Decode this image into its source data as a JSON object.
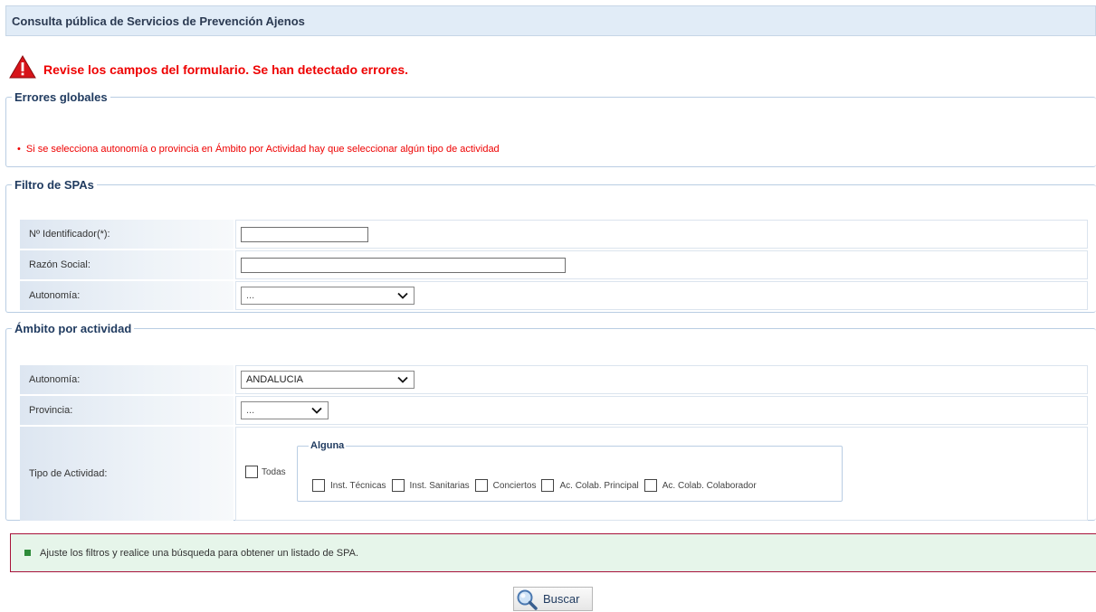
{
  "page": {
    "title": "Consulta pública de Servicios de Prevención Ajenos"
  },
  "errors": {
    "header": "Revise los campos del formulario. Se han detectado errores.",
    "icon": "warning-icon",
    "global_legend": "Errores globales",
    "items": [
      "Si se selecciona autonomía o provincia en Ámbito por Actividad hay que seleccionar algún tipo de actividad"
    ]
  },
  "filtro": {
    "legend": "Filtro de SPAs",
    "identificador_label": "Nº Identificador(*):",
    "identificador_value": "",
    "razon_label": "Razón Social:",
    "razon_value": "",
    "autonomia_label": "Autonomía:",
    "autonomia_value": "..."
  },
  "ambito": {
    "legend": "Ámbito por actividad",
    "autonomia_label": "Autonomía:",
    "autonomia_value": "ANDALUCIA",
    "provincia_label": "Provincia:",
    "provincia_value": "...",
    "tipo_label": "Tipo de Actividad:",
    "todas_label": "Todas",
    "alguna_legend": "Alguna",
    "alguna_items": [
      "Inst. Técnicas",
      "Inst. Sanitarias",
      "Conciertos",
      "Ac. Colab. Principal",
      "Ac. Colab. Colaborador"
    ]
  },
  "info": {
    "message": "Ajuste los filtros y realice una búsqueda para obtener un listado de SPA."
  },
  "actions": {
    "buscar_label": "Buscar",
    "buscar_icon": "magnifier-icon"
  },
  "colors": {
    "error": "#ee0000",
    "title_bg": "#e1ecf7",
    "info_bg": "#e6f5ea",
    "info_border": "#a8123a"
  }
}
